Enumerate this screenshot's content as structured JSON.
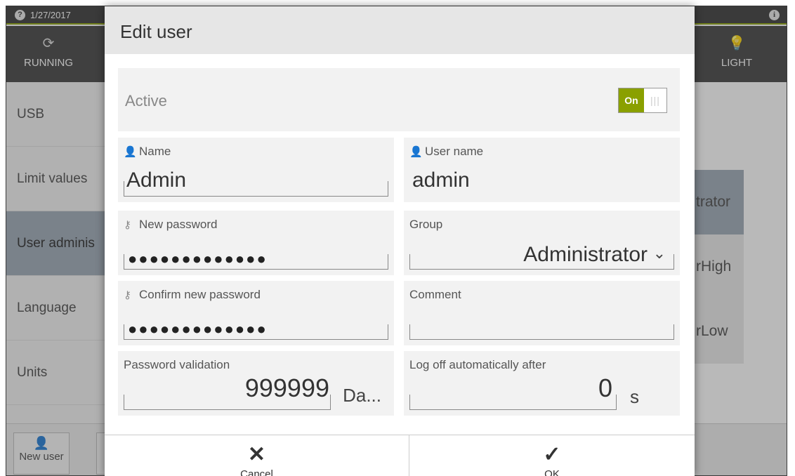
{
  "status": {
    "date": "1/27/2017"
  },
  "toolbar": {
    "running_label": "RUNNING",
    "light_label": "LIGHT"
  },
  "sidebar": {
    "items": [
      {
        "label": "USB"
      },
      {
        "label": "Limit values"
      },
      {
        "label": "User adminis"
      },
      {
        "label": "Language"
      },
      {
        "label": "Units"
      }
    ]
  },
  "content_list": {
    "items": [
      {
        "label": "trator"
      },
      {
        "label": "rHigh"
      },
      {
        "label": "rLow"
      }
    ]
  },
  "bottombar": {
    "new_user_label": "New user"
  },
  "dialog": {
    "title": "Edit user",
    "active": {
      "label": "Active",
      "toggle_label": "On"
    },
    "name": {
      "label": "Name",
      "value": "Admin"
    },
    "username": {
      "label": "User name",
      "value": "admin"
    },
    "new_password": {
      "label": "New password",
      "value": "●●●●●●●●●●●●●"
    },
    "group": {
      "label": "Group",
      "value": "Administrator"
    },
    "confirm_password": {
      "label": "Confirm new password",
      "value": "●●●●●●●●●●●●●"
    },
    "comment": {
      "label": "Comment",
      "value": ""
    },
    "password_validation": {
      "label": "Password validation",
      "value": "999999",
      "unit": "Da..."
    },
    "logoff": {
      "label": "Log off automatically after",
      "value": "0",
      "unit": "s"
    },
    "cancel_label": "Cancel",
    "ok_label": "OK"
  },
  "colors": {
    "accent": "#8aa000",
    "header_bg": "#e6e6e6",
    "field_bg": "#f2f2f2"
  }
}
